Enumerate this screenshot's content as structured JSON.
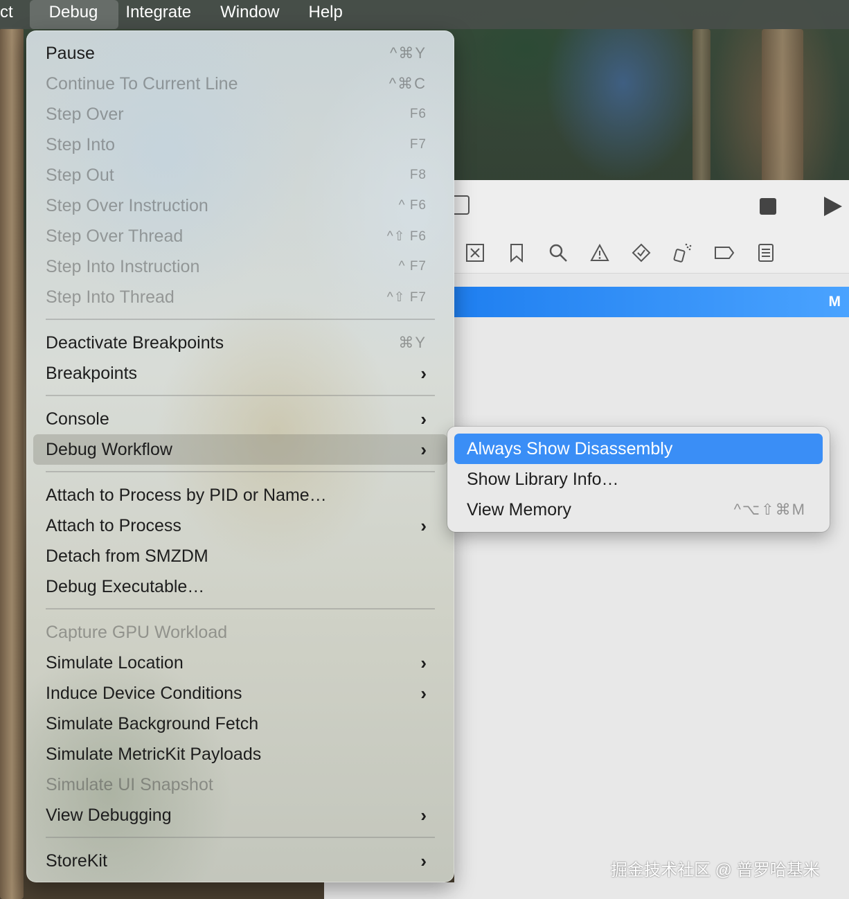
{
  "menubar": {
    "items": [
      {
        "label": "ct"
      },
      {
        "label": "Debug"
      },
      {
        "label": "Integrate"
      },
      {
        "label": "Window"
      },
      {
        "label": "Help"
      }
    ]
  },
  "debug_menu": {
    "items": [
      {
        "label": "Pause",
        "shortcut": "^⌘Y"
      },
      {
        "label": "Continue To Current Line",
        "shortcut": "^⌘C"
      },
      {
        "label": "Step Over",
        "shortcut": "F6"
      },
      {
        "label": "Step Into",
        "shortcut": "F7"
      },
      {
        "label": "Step Out",
        "shortcut": "F8"
      },
      {
        "label": "Step Over Instruction",
        "shortcut": "^ F6"
      },
      {
        "label": "Step Over Thread",
        "shortcut": "^⇧ F6"
      },
      {
        "label": "Step Into Instruction",
        "shortcut": "^ F7"
      },
      {
        "label": "Step Into Thread",
        "shortcut": "^⇧ F7"
      },
      {
        "label": "Deactivate Breakpoints",
        "shortcut": "⌘Y"
      },
      {
        "label": "Breakpoints",
        "submenu_glyph": "›"
      },
      {
        "label": "Console",
        "submenu_glyph": "›"
      },
      {
        "label": "Debug Workflow",
        "submenu_glyph": "›"
      },
      {
        "label": "Attach to Process by PID or Name…"
      },
      {
        "label": "Attach to Process",
        "submenu_glyph": "›"
      },
      {
        "label": "Detach from SMZDM"
      },
      {
        "label": "Debug Executable…"
      },
      {
        "label": "Capture GPU Workload"
      },
      {
        "label": "Simulate Location",
        "submenu_glyph": "›"
      },
      {
        "label": "Induce Device Conditions",
        "submenu_glyph": "›"
      },
      {
        "label": "Simulate Background Fetch"
      },
      {
        "label": "Simulate MetricKit Payloads"
      },
      {
        "label": "Simulate UI Snapshot"
      },
      {
        "label": "View Debugging",
        "submenu_glyph": "›"
      },
      {
        "label": "StoreKit",
        "submenu_glyph": "›"
      }
    ]
  },
  "debug_workflow_submenu": {
    "items": [
      {
        "label": "Always Show Disassembly"
      },
      {
        "label": "Show Library Info…"
      },
      {
        "label": "View Memory",
        "shortcut": "^⌥⇧⌘M"
      }
    ]
  },
  "xcode": {
    "selected_row_label": "M"
  },
  "watermark": "掘金技术社区 @ 普罗哈基米",
  "colors": {
    "selection_blue": "#3a8ef6",
    "menubar_bg": "#484e4a"
  }
}
